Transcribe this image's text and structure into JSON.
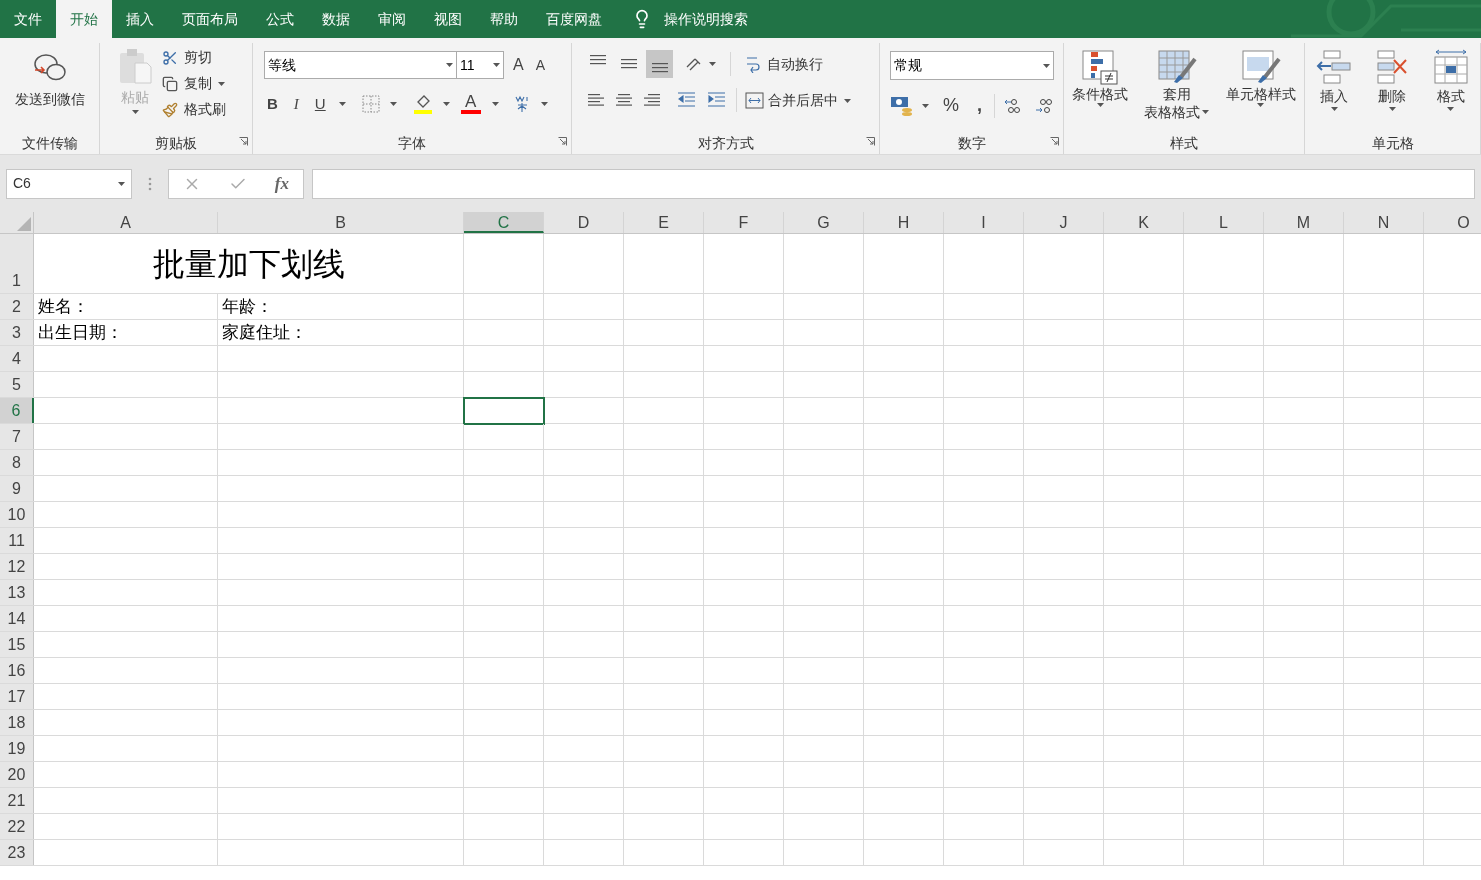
{
  "menu_tabs": [
    {
      "label": "文件",
      "selected": false
    },
    {
      "label": "开始",
      "selected": true
    },
    {
      "label": "插入",
      "selected": false
    },
    {
      "label": "页面布局",
      "selected": false
    },
    {
      "label": "公式",
      "selected": false
    },
    {
      "label": "数据",
      "selected": false
    },
    {
      "label": "审阅",
      "selected": false
    },
    {
      "label": "视图",
      "selected": false
    },
    {
      "label": "帮助",
      "selected": false
    },
    {
      "label": "百度网盘",
      "selected": false
    }
  ],
  "tell_me": "操作说明搜索",
  "ribbon": {
    "transfer": {
      "send": "发送到微信",
      "label": "文件传输"
    },
    "clipboard": {
      "paste": "粘贴",
      "cut": "剪切",
      "copy": "复制",
      "format_painter": "格式刷",
      "label": "剪贴板"
    },
    "font": {
      "name": "等线",
      "size": "11",
      "grow": "A",
      "shrink": "A",
      "bold": "B",
      "italic": "I",
      "underline": "U",
      "font_color": "A",
      "label": "字体"
    },
    "alignment": {
      "vertical": [
        {
          "kind": "top",
          "selected": false
        },
        {
          "kind": "middle",
          "selected": false
        },
        {
          "kind": "bottom",
          "selected": true
        }
      ],
      "horizontal": [
        {
          "kind": "left"
        },
        {
          "kind": "center"
        },
        {
          "kind": "right"
        }
      ],
      "wrap": "自动换行",
      "merge": "合并后居中",
      "label": "对齐方式"
    },
    "number": {
      "format": "常规",
      "percent": "%",
      "comma": ",",
      "label": "数字"
    },
    "styles": {
      "conditional": "条件格式",
      "table_top": "套用",
      "table_bottom": "表格格式",
      "cell": "单元格样式",
      "label": "样式"
    },
    "cells": {
      "insert": "插入",
      "delete": "删除",
      "format": "格式",
      "label": "单元格"
    }
  },
  "name_box": "C6",
  "formula_bar": {
    "function_label": "fx"
  },
  "columns": [
    {
      "label": "A",
      "selected": false
    },
    {
      "label": "B",
      "selected": false
    },
    {
      "label": "C",
      "selected": true
    },
    {
      "label": "D",
      "selected": false
    },
    {
      "label": "E",
      "selected": false
    },
    {
      "label": "F",
      "selected": false
    },
    {
      "label": "G",
      "selected": false
    },
    {
      "label": "H",
      "selected": false
    },
    {
      "label": "I",
      "selected": false
    },
    {
      "label": "J",
      "selected": false
    },
    {
      "label": "K",
      "selected": false
    },
    {
      "label": "L",
      "selected": false
    },
    {
      "label": "M",
      "selected": false
    },
    {
      "label": "N",
      "selected": false
    },
    {
      "label": "O",
      "selected": false
    }
  ],
  "rows": [
    {
      "header": "1",
      "selected": false,
      "title": "批量加下划线"
    },
    {
      "header": "2",
      "selected": false,
      "cells": [
        "姓名：",
        "年龄："
      ]
    },
    {
      "header": "3",
      "selected": false,
      "cells": [
        "出生日期：",
        "家庭住址："
      ]
    },
    {
      "header": "4",
      "selected": false
    },
    {
      "header": "5",
      "selected": false
    },
    {
      "header": "6",
      "selected": true
    },
    {
      "header": "7",
      "selected": false
    },
    {
      "header": "8",
      "selected": false
    },
    {
      "header": "9",
      "selected": false
    },
    {
      "header": "10",
      "selected": false
    },
    {
      "header": "11",
      "selected": false
    },
    {
      "header": "12",
      "selected": false
    },
    {
      "header": "13",
      "selected": false
    },
    {
      "header": "14",
      "selected": false
    },
    {
      "header": "15",
      "selected": false
    },
    {
      "header": "16",
      "selected": false
    },
    {
      "header": "17",
      "selected": false
    },
    {
      "header": "18",
      "selected": false
    },
    {
      "header": "19",
      "selected": false
    },
    {
      "header": "20",
      "selected": false
    },
    {
      "header": "21",
      "selected": false
    },
    {
      "header": "22",
      "selected": false
    },
    {
      "header": "23",
      "selected": false
    }
  ]
}
